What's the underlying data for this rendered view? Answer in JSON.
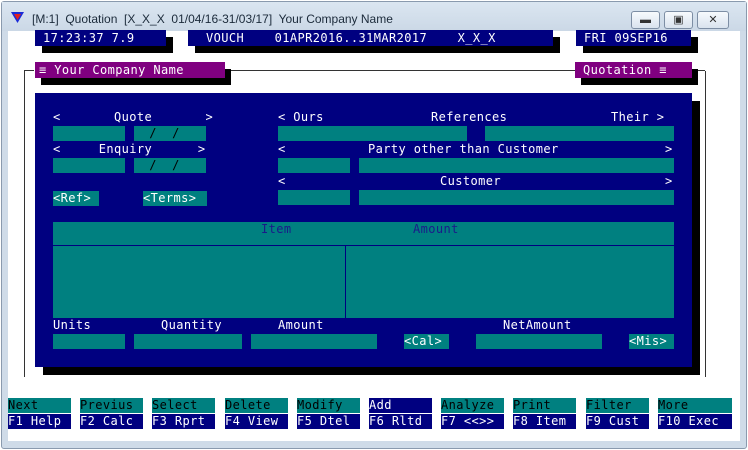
{
  "window": {
    "title": "[M:1]  Quotation  [X_X_X  01/04/16-31/03/17]  Your Company Name",
    "minimize_glyph": "▬",
    "maximize_glyph": "▣",
    "close_glyph": "✕"
  },
  "status": {
    "clock": "17:23:37 7.9",
    "voucher_info": "VOUCH    01APR2016..31MAR2017    X_X_X",
    "date": "FRI 09SEP16"
  },
  "header": {
    "company": "≡ Your Company Name",
    "module": "Quotation ≡"
  },
  "form": {
    "quote_label": "<       Quote       >",
    "date_placeholder": "  /  /",
    "enquiry_label": "<     Enquiry      >",
    "enquiry_date_placeholder": "  /  /",
    "ref_button": "<Ref>",
    "terms_button": "<Terms>",
    "ours_label": "< Ours",
    "references_label": "References",
    "their_label": "Their >",
    "party_open": "<",
    "party_label": "Party other than Customer",
    "party_close": ">",
    "customer_open": "<",
    "customer_label": "Customer",
    "customer_close": ">",
    "grid_item_header": "Item",
    "grid_amount_header": "Amount",
    "units_label": "Units",
    "quantity_label": "Quantity",
    "amount_label": "Amount",
    "netamount_label": "NetAmount",
    "cal_button": "<Cal>",
    "mis_button": "<Mis>"
  },
  "function_keys": [
    {
      "top": "Next",
      "bottom": "F1 Help",
      "active": false
    },
    {
      "top": "Previus",
      "bottom": "F2 Calc",
      "active": false
    },
    {
      "top": "Select",
      "bottom": "F3 Rprt",
      "active": false
    },
    {
      "top": "Delete",
      "bottom": "F4 View",
      "active": false
    },
    {
      "top": "Modify",
      "bottom": "F5 Dtel",
      "active": false
    },
    {
      "top": "Add",
      "bottom": "F6 Rltd",
      "active": true
    },
    {
      "top": "Analyze",
      "bottom": "F7 <<>>",
      "active": false
    },
    {
      "top": "Print",
      "bottom": "F8 Item",
      "active": false
    },
    {
      "top": "Filter",
      "bottom": "F9 Cust",
      "active": false
    },
    {
      "top": "More",
      "bottom": "F10 Exec",
      "active": false
    }
  ],
  "colors": {
    "navy": "#000080",
    "teal": "#008080",
    "magenta": "#800080"
  }
}
